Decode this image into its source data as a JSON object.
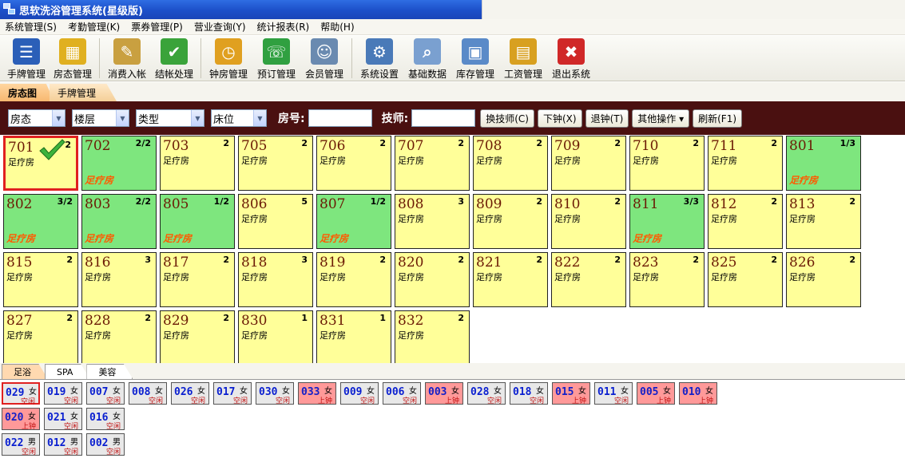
{
  "window": {
    "title": "思软洗浴管理系统(星级版)"
  },
  "menu": [
    "系统管理(S)",
    "考勤管理(K)",
    "票券管理(P)",
    "营业查询(Y)",
    "统计报表(R)",
    "帮助(H)"
  ],
  "toolbar": [
    {
      "label": "手牌管理",
      "icon": "hand-card-icon",
      "color": "#2b5fb8",
      "glyph": "☰"
    },
    {
      "label": "房态管理",
      "icon": "room-status-icon",
      "color": "#e0b020",
      "glyph": "▦"
    },
    {
      "sep": true
    },
    {
      "label": "消费入帐",
      "icon": "clipboard-icon",
      "color": "#c9a040",
      "glyph": "✎"
    },
    {
      "label": "结帐处理",
      "icon": "checkout-icon",
      "color": "#3aa33a",
      "glyph": "✔"
    },
    {
      "sep": true
    },
    {
      "label": "钟房管理",
      "icon": "alarm-clock-icon",
      "color": "#e0a020",
      "glyph": "◷"
    },
    {
      "label": "预订管理",
      "icon": "phone-icon",
      "color": "#30a040",
      "glyph": "☏"
    },
    {
      "label": "会员管理",
      "icon": "members-icon",
      "color": "#6a8ab0",
      "glyph": "☺"
    },
    {
      "sep": true
    },
    {
      "label": "系统设置",
      "icon": "settings-icon",
      "color": "#4a7ab8",
      "glyph": "⚙"
    },
    {
      "label": "基础数据",
      "icon": "database-icon",
      "color": "#7aa0d0",
      "glyph": "⌕"
    },
    {
      "label": "库存管理",
      "icon": "inventory-icon",
      "color": "#5a8ac8",
      "glyph": "▣"
    },
    {
      "label": "工资管理",
      "icon": "salary-book-icon",
      "color": "#d8a020",
      "glyph": "▤"
    },
    {
      "label": "退出系统",
      "icon": "exit-icon",
      "color": "#d02828",
      "glyph": "✖"
    }
  ],
  "view_tabs": {
    "active": "房态图",
    "inactive": "手牌管理"
  },
  "filters": {
    "selects": [
      {
        "name": "room-state-select",
        "value": "房态",
        "width": 72
      },
      {
        "name": "floor-select",
        "value": "楼层",
        "width": 72
      },
      {
        "name": "room-type-select",
        "value": "类型",
        "width": 86
      },
      {
        "name": "bed-select",
        "value": "床位",
        "width": 70
      }
    ],
    "room_no_label": "房号:",
    "tech_label": "技师:",
    "buttons": [
      "换技师(C)",
      "下钟(X)",
      "退钟(T)",
      "其他操作 ▾",
      "刷新(F1)"
    ]
  },
  "rooms": [
    {
      "num": "701",
      "count": "2",
      "type": "足疗房",
      "status": "",
      "occupied": false,
      "selected": true,
      "checked": true
    },
    {
      "num": "702",
      "count": "2/2",
      "type": "",
      "status": "足疗房",
      "occupied": true
    },
    {
      "num": "703",
      "count": "2",
      "type": "足疗房",
      "status": "",
      "occupied": false
    },
    {
      "num": "705",
      "count": "2",
      "type": "足疗房",
      "status": "",
      "occupied": false
    },
    {
      "num": "706",
      "count": "2",
      "type": "足疗房",
      "status": "",
      "occupied": false
    },
    {
      "num": "707",
      "count": "2",
      "type": "足疗房",
      "status": "",
      "occupied": false
    },
    {
      "num": "708",
      "count": "2",
      "type": "足疗房",
      "status": "",
      "occupied": false
    },
    {
      "num": "709",
      "count": "2",
      "type": "足疗房",
      "status": "",
      "occupied": false
    },
    {
      "num": "710",
      "count": "2",
      "type": "足疗房",
      "status": "",
      "occupied": false
    },
    {
      "num": "711",
      "count": "2",
      "type": "足疗房",
      "status": "",
      "occupied": false
    },
    {
      "num": "801",
      "count": "1/3",
      "type": "",
      "status": "足疗房",
      "occupied": true
    },
    {
      "num": "802",
      "count": "3/2",
      "type": "",
      "status": "足疗房",
      "occupied": true
    },
    {
      "num": "803",
      "count": "2/2",
      "type": "",
      "status": "足疗房",
      "occupied": true
    },
    {
      "num": "805",
      "count": "1/2",
      "type": "",
      "status": "足疗房",
      "occupied": true
    },
    {
      "num": "806",
      "count": "5",
      "type": "足疗房",
      "status": "",
      "occupied": false
    },
    {
      "num": "807",
      "count": "1/2",
      "type": "",
      "status": "足疗房",
      "occupied": true
    },
    {
      "num": "808",
      "count": "3",
      "type": "足疗房",
      "status": "",
      "occupied": false
    },
    {
      "num": "809",
      "count": "2",
      "type": "足疗房",
      "status": "",
      "occupied": false
    },
    {
      "num": "810",
      "count": "2",
      "type": "足疗房",
      "status": "",
      "occupied": false
    },
    {
      "num": "811",
      "count": "3/3",
      "type": "",
      "status": "足疗房",
      "occupied": true
    },
    {
      "num": "812",
      "count": "2",
      "type": "足疗房",
      "status": "",
      "occupied": false
    },
    {
      "num": "813",
      "count": "2",
      "type": "足疗房",
      "status": "",
      "occupied": false
    },
    {
      "num": "815",
      "count": "2",
      "type": "足疗房",
      "status": "",
      "occupied": false
    },
    {
      "num": "816",
      "count": "3",
      "type": "足疗房",
      "status": "",
      "occupied": false
    },
    {
      "num": "817",
      "count": "2",
      "type": "足疗房",
      "status": "",
      "occupied": false
    },
    {
      "num": "818",
      "count": "3",
      "type": "足疗房",
      "status": "",
      "occupied": false
    },
    {
      "num": "819",
      "count": "2",
      "type": "足疗房",
      "status": "",
      "occupied": false
    },
    {
      "num": "820",
      "count": "2",
      "type": "足疗房",
      "status": "",
      "occupied": false
    },
    {
      "num": "821",
      "count": "2",
      "type": "足疗房",
      "status": "",
      "occupied": false
    },
    {
      "num": "822",
      "count": "2",
      "type": "足疗房",
      "status": "",
      "occupied": false
    },
    {
      "num": "823",
      "count": "2",
      "type": "足疗房",
      "status": "",
      "occupied": false
    },
    {
      "num": "825",
      "count": "2",
      "type": "足疗房",
      "status": "",
      "occupied": false
    },
    {
      "num": "826",
      "count": "2",
      "type": "足疗房",
      "status": "",
      "occupied": false
    },
    {
      "num": "827",
      "count": "2",
      "type": "足疗房",
      "status": "",
      "occupied": false
    },
    {
      "num": "828",
      "count": "2",
      "type": "足疗房",
      "status": "",
      "occupied": false
    },
    {
      "num": "829",
      "count": "2",
      "type": "足疗房",
      "status": "",
      "occupied": false
    },
    {
      "num": "830",
      "count": "1",
      "type": "足疗房",
      "status": "",
      "occupied": false
    },
    {
      "num": "831",
      "count": "1",
      "type": "足疗房",
      "status": "",
      "occupied": false
    },
    {
      "num": "832",
      "count": "2",
      "type": "足疗房",
      "status": "",
      "occupied": false
    }
  ],
  "category_tabs": [
    {
      "label": "足浴",
      "active": true
    },
    {
      "label": "SPA",
      "active": false
    },
    {
      "label": "美容",
      "active": false
    }
  ],
  "technician_rows": [
    [
      {
        "num": "029",
        "gender": "女",
        "status": "空闲",
        "busy": false,
        "selected": true
      },
      {
        "num": "019",
        "gender": "女",
        "status": "空闲",
        "busy": false
      },
      {
        "num": "007",
        "gender": "女",
        "status": "空闲",
        "busy": false
      },
      {
        "num": "008",
        "gender": "女",
        "status": "空闲",
        "busy": false
      },
      {
        "num": "026",
        "gender": "女",
        "status": "空闲",
        "busy": false
      },
      {
        "num": "017",
        "gender": "女",
        "status": "空闲",
        "busy": false
      },
      {
        "num": "030",
        "gender": "女",
        "status": "空闲",
        "busy": false
      },
      {
        "num": "033",
        "gender": "女",
        "status": "上钟",
        "busy": true
      },
      {
        "num": "009",
        "gender": "女",
        "status": "空闲",
        "busy": false
      },
      {
        "num": "006",
        "gender": "女",
        "status": "空闲",
        "busy": false
      },
      {
        "num": "003",
        "gender": "女",
        "status": "上钟",
        "busy": true
      },
      {
        "num": "028",
        "gender": "女",
        "status": "空闲",
        "busy": false
      },
      {
        "num": "018",
        "gender": "女",
        "status": "空闲",
        "busy": false
      },
      {
        "num": "015",
        "gender": "女",
        "status": "上钟",
        "busy": true
      },
      {
        "num": "011",
        "gender": "女",
        "status": "空闲",
        "busy": false
      },
      {
        "num": "005",
        "gender": "女",
        "status": "上钟",
        "busy": true
      },
      {
        "num": "010",
        "gender": "女",
        "status": "上钟",
        "busy": true
      }
    ],
    [
      {
        "num": "020",
        "gender": "女",
        "status": "上钟",
        "busy": true
      },
      {
        "num": "021",
        "gender": "女",
        "status": "空闲",
        "busy": false
      },
      {
        "num": "016",
        "gender": "女",
        "status": "空闲",
        "busy": false
      }
    ],
    [
      {
        "num": "022",
        "gender": "男",
        "status": "空闲",
        "busy": false
      },
      {
        "num": "012",
        "gender": "男",
        "status": "空闲",
        "busy": false
      },
      {
        "num": "002",
        "gender": "男",
        "status": "空闲",
        "busy": false
      }
    ]
  ]
}
